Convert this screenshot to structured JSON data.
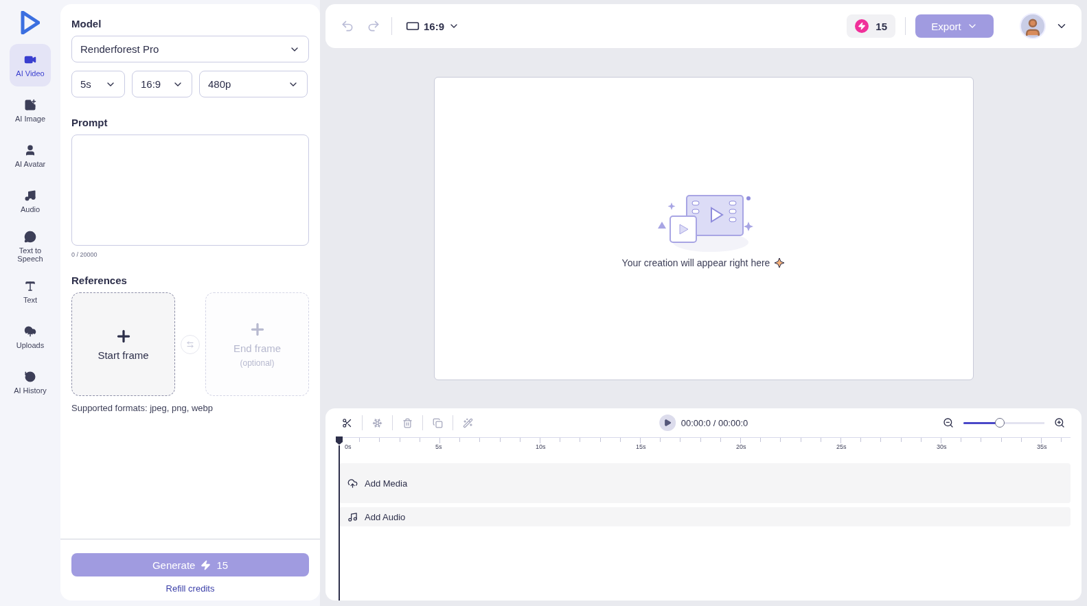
{
  "nav": [
    {
      "label": "AI Video",
      "selected": true
    },
    {
      "label": "AI Image",
      "selected": false
    },
    {
      "label": "AI Avatar",
      "selected": false
    },
    {
      "label": "Audio",
      "selected": false
    },
    {
      "label": "Text to Speech",
      "selected": false
    },
    {
      "label": "Text",
      "selected": false
    },
    {
      "label": "Uploads",
      "selected": false
    },
    {
      "label": "AI History",
      "selected": false
    }
  ],
  "panel": {
    "model_label": "Model",
    "model": "Renderforest Pro",
    "duration": "5s",
    "ratio": "16:9",
    "resolution": "480p",
    "prompt_label": "Prompt",
    "prompt_counter": "0 / 20000",
    "references_label": "References",
    "frames": [
      {
        "label": "Start frame",
        "disabled": false
      },
      {
        "label": "End frame",
        "note": "(optional)",
        "disabled": true
      }
    ],
    "formats": "Supported formats: jpeg, png, webp",
    "generate": "Generate",
    "generate_cost": "15",
    "refill": "Refill credits"
  },
  "topbar": {
    "aspect": "16:9",
    "credits": "15",
    "export": "Export"
  },
  "canvas": {
    "message": "Your creation will appear right here"
  },
  "timeline": {
    "time": "00:00:0 / 00:00:0",
    "zoom": {
      "level": 0.45
    },
    "ruler": [
      "0s",
      "5s",
      "10s",
      "15s",
      "20s",
      "25s",
      "30s",
      "35s"
    ],
    "tracks": [
      {
        "kind": "media",
        "label": "Add Media"
      },
      {
        "kind": "audio",
        "label": "Add Audio"
      }
    ]
  }
}
